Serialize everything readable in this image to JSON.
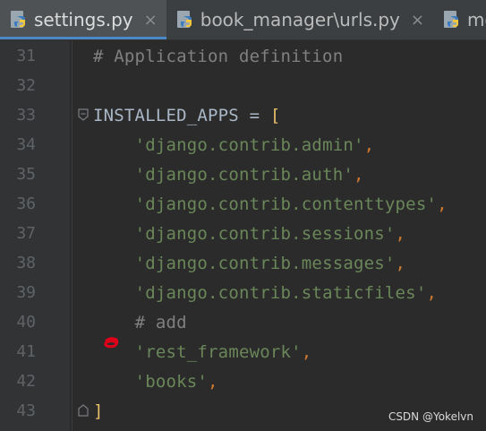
{
  "tabs": [
    {
      "label": "settings.py",
      "close": "×",
      "active": true
    },
    {
      "label": "book_manager\\urls.py",
      "close": "×",
      "active": false
    },
    {
      "label": "models.",
      "close": "",
      "active": false
    }
  ],
  "lines": [
    {
      "num": "31",
      "comment": "# Application definition"
    },
    {
      "num": "32"
    },
    {
      "num": "33",
      "ident": "INSTALLED_APPS",
      "op": " = ",
      "bracket": "["
    },
    {
      "num": "34",
      "indent": "    ",
      "string": "'django.contrib.admin'",
      "punct": ","
    },
    {
      "num": "35",
      "indent": "    ",
      "string": "'django.contrib.auth'",
      "punct": ","
    },
    {
      "num": "36",
      "indent": "    ",
      "string": "'django.contrib.contenttypes'",
      "punct": ","
    },
    {
      "num": "37",
      "indent": "    ",
      "string": "'django.contrib.sessions'",
      "punct": ","
    },
    {
      "num": "38",
      "indent": "    ",
      "string": "'django.contrib.messages'",
      "punct": ","
    },
    {
      "num": "39",
      "indent": "    ",
      "string": "'django.contrib.staticfiles'",
      "punct": ","
    },
    {
      "num": "40",
      "indent": "    ",
      "comment": "# add"
    },
    {
      "num": "41",
      "indent": "    ",
      "string": "'rest_framework'",
      "punct": ","
    },
    {
      "num": "42",
      "indent": "    ",
      "string": "'books'",
      "punct": ","
    },
    {
      "num": "43",
      "bracket": "]"
    }
  ],
  "watermark": "CSDN @Yokelvn",
  "colors": {
    "background": "#2b2b2b",
    "gutter": "#313335",
    "string": "#6a8759",
    "comment": "#808080",
    "keyword_punct": "#cc7832",
    "marker": "#e0001a"
  },
  "icons": {
    "tab": "python-file-icon",
    "fold": "fold-marker-icon",
    "annotation": "red-scribble-mark"
  }
}
